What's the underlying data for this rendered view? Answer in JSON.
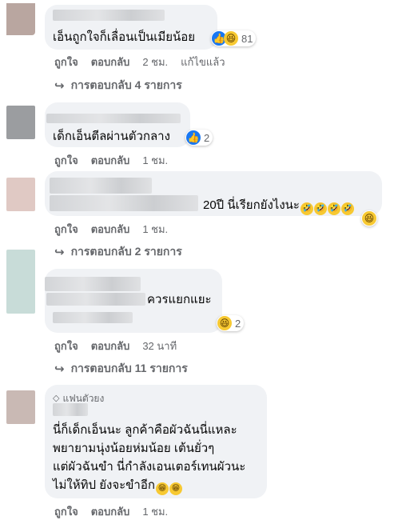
{
  "comments": [
    {
      "text": "เอ็นถูกใจก็เลื่อนเป็นเมียน้อย",
      "reaction_count": "81",
      "actions": {
        "like": "ถูกใจ",
        "reply": "ตอบกลับ",
        "time": "2 ชม.",
        "edited": "แก้ไขแล้ว"
      },
      "replies": "การตอบกลับ 4 รายการ",
      "avatar_color": "#b9a6a0"
    },
    {
      "text": "เด็กเอ็นตีลผ่านตัวกลาง",
      "reaction_count": "2",
      "actions": {
        "like": "ถูกใจ",
        "reply": "ตอบกลับ",
        "time": "1 ชม."
      },
      "avatar_color": "#9b9da0"
    },
    {
      "text": "20ปี นี่เรียกยังไงนะ",
      "actions": {
        "like": "ถูกใจ",
        "reply": "ตอบกลับ",
        "time": "1 ชม."
      },
      "replies": "การตอบกลับ 2 รายการ",
      "avatar_color": "#e0c9c4"
    },
    {
      "text": "ควรแยกแยะ",
      "reaction_count": "2",
      "actions": {
        "like": "ถูกใจ",
        "reply": "ตอบกลับ",
        "time": "32 นาที"
      },
      "replies": "การตอบกลับ 11 รายการ",
      "avatar_color": "#c8dcd8"
    },
    {
      "badge": "แฟนตัวยง",
      "lines": [
        "นี่ก็เด็กเอ็นนะ ลูกค้าคือผัวฉันนี่แหละ",
        "พยายามนุ่งน้อยห่มน้อย เต้นยั่วๆ",
        "แต่ผัวฉันขำ นี่กำลังเอนเตอร์เทนผัวนะ",
        "ไม่ให้ทิป ยังจะขำอีก"
      ],
      "actions": {
        "like": "ถูกใจ",
        "reply": "ตอบกลับ",
        "time": "1 ชม."
      },
      "avatar_color": "#c9b9b4"
    }
  ],
  "colors": {
    "bubble": "#f0f2f5",
    "meta": "#65676b",
    "like": "#1877f2",
    "haha": "#f7c932"
  },
  "icons": {
    "like": "like-icon",
    "haha": "haha-icon",
    "reply_arrow": "reply-arrow-icon",
    "fan": "diamond-icon"
  }
}
